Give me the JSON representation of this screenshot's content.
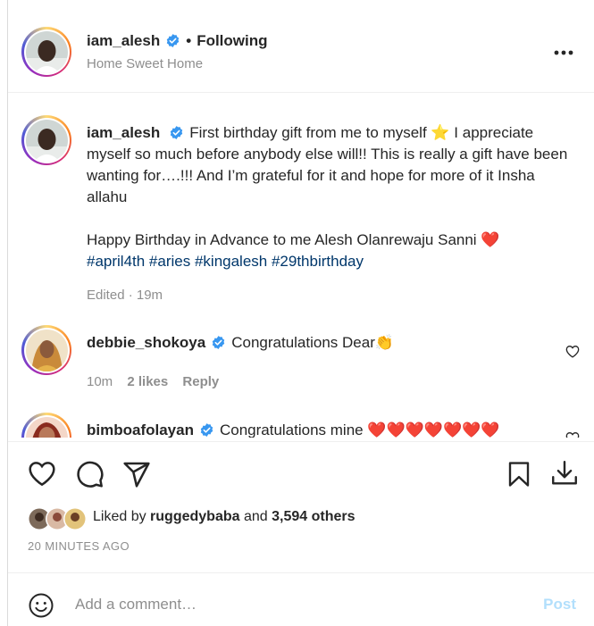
{
  "header": {
    "username": "iam_alesh",
    "dot": "•",
    "follow_state": "Following",
    "location": "Home Sweet Home",
    "more_icon": "more-horizontal-icon"
  },
  "post": {
    "username": "iam_alesh",
    "caption_part1": "First birthday gift from me to myself ⭐ I appreciate myself so much before anybody else will!! This is really a gift have been wanting for….!!! And I’m grateful for it and hope for more of it Insha allahu",
    "caption_part2": "Happy Birthday in Advance to me Alesh Olanrewaju Sanni ❤️",
    "hashtags": "#april4th #aries #kingalesh #29thbirthday",
    "meta_edited": "Edited · 19m"
  },
  "comments": [
    {
      "username": "debbie_shokoya",
      "text": "Congratulations Dear👏",
      "time": "10m",
      "likes": "2 likes",
      "reply": "Reply"
    },
    {
      "username": "bimboafolayan",
      "text": "Congratulations mine ❤️❤️❤️❤️❤️❤️❤️"
    }
  ],
  "actions": {
    "like_icon": "heart-icon",
    "comment_icon": "comment-icon",
    "share_icon": "send-icon",
    "save_icon": "bookmark-icon",
    "download_icon": "download-icon"
  },
  "likes_line": {
    "prefix": "Liked by",
    "user": "ruggedybaba",
    "middle": "and",
    "count": "3,594 others"
  },
  "time_ago": "20 MINUTES AGO",
  "add_comment": {
    "placeholder": "Add a comment…",
    "post_label": "Post"
  },
  "colors": {
    "verified": "#3897f0",
    "hashtag": "#00376b",
    "post_disabled": "#b2dffc",
    "secondary_text": "#8e8e8e"
  }
}
